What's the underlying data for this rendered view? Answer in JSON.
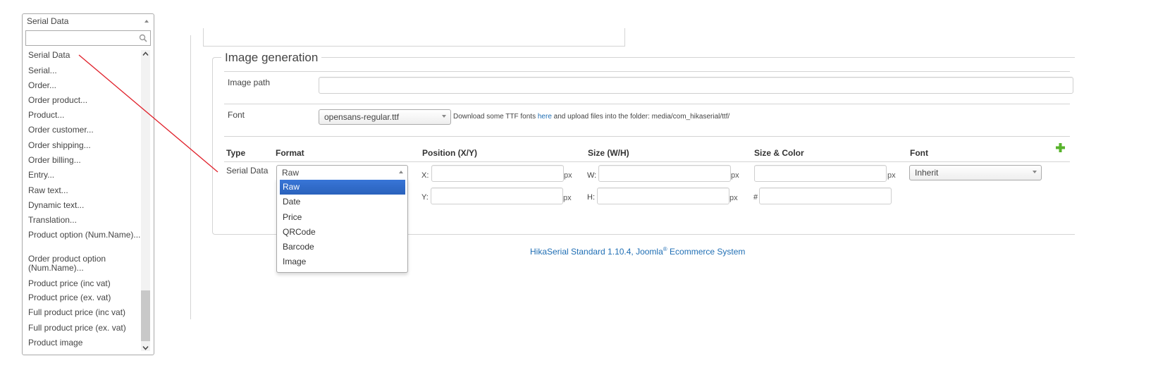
{
  "left_dropdown": {
    "selected": "Serial Data",
    "search_placeholder": "",
    "items": [
      "Serial Data",
      "Serial...",
      "Order...",
      "Order product...",
      "Product...",
      "Order customer...",
      "Order shipping...",
      "Order billing...",
      "Entry...",
      "Raw text...",
      "Dynamic text...",
      "Translation...",
      "Product option (Num.Name)...",
      "Order product option (Num.Name)...",
      "Product price (inc vat)",
      "Product price (ex. vat)",
      "Full product price (inc vat)",
      "Full product price (ex. vat)",
      "Product image"
    ]
  },
  "image_generation": {
    "legend": "Image generation",
    "image_path_label": "Image path",
    "image_path_value": "",
    "font_label": "Font",
    "font_value": "opensans-regular.ttf",
    "font_help_prefix": "Download some TTF fonts ",
    "font_help_link": "here",
    "font_help_suffix": " and upload files into the folder: media/com_hikaserial/ttf/"
  },
  "table": {
    "headers": {
      "type": "Type",
      "format": "Format",
      "position": "Position (X/Y)",
      "size": "Size (W/H)",
      "size_color": "Size & Color",
      "font": "Font"
    },
    "row": {
      "type": "Serial Data",
      "format_value": "Raw",
      "x_label": "X:",
      "y_label": "Y:",
      "w_label": "W:",
      "h_label": "H:",
      "px": "px",
      "hash": "#",
      "font_value": "Inherit"
    },
    "format_options": [
      "Raw",
      "Date",
      "Price",
      "QRCode",
      "Barcode",
      "Image"
    ],
    "add_icon": "plus-icon"
  },
  "footer": {
    "text": "HikaSerial Standard 1.10.4, Joomla",
    "reg": "®",
    "suffix": " Ecommerce System"
  },
  "colors": {
    "accent": "#3875d7",
    "link": "#1f6eb4",
    "arrow": "#e0212b",
    "plus": "#58b32c"
  }
}
